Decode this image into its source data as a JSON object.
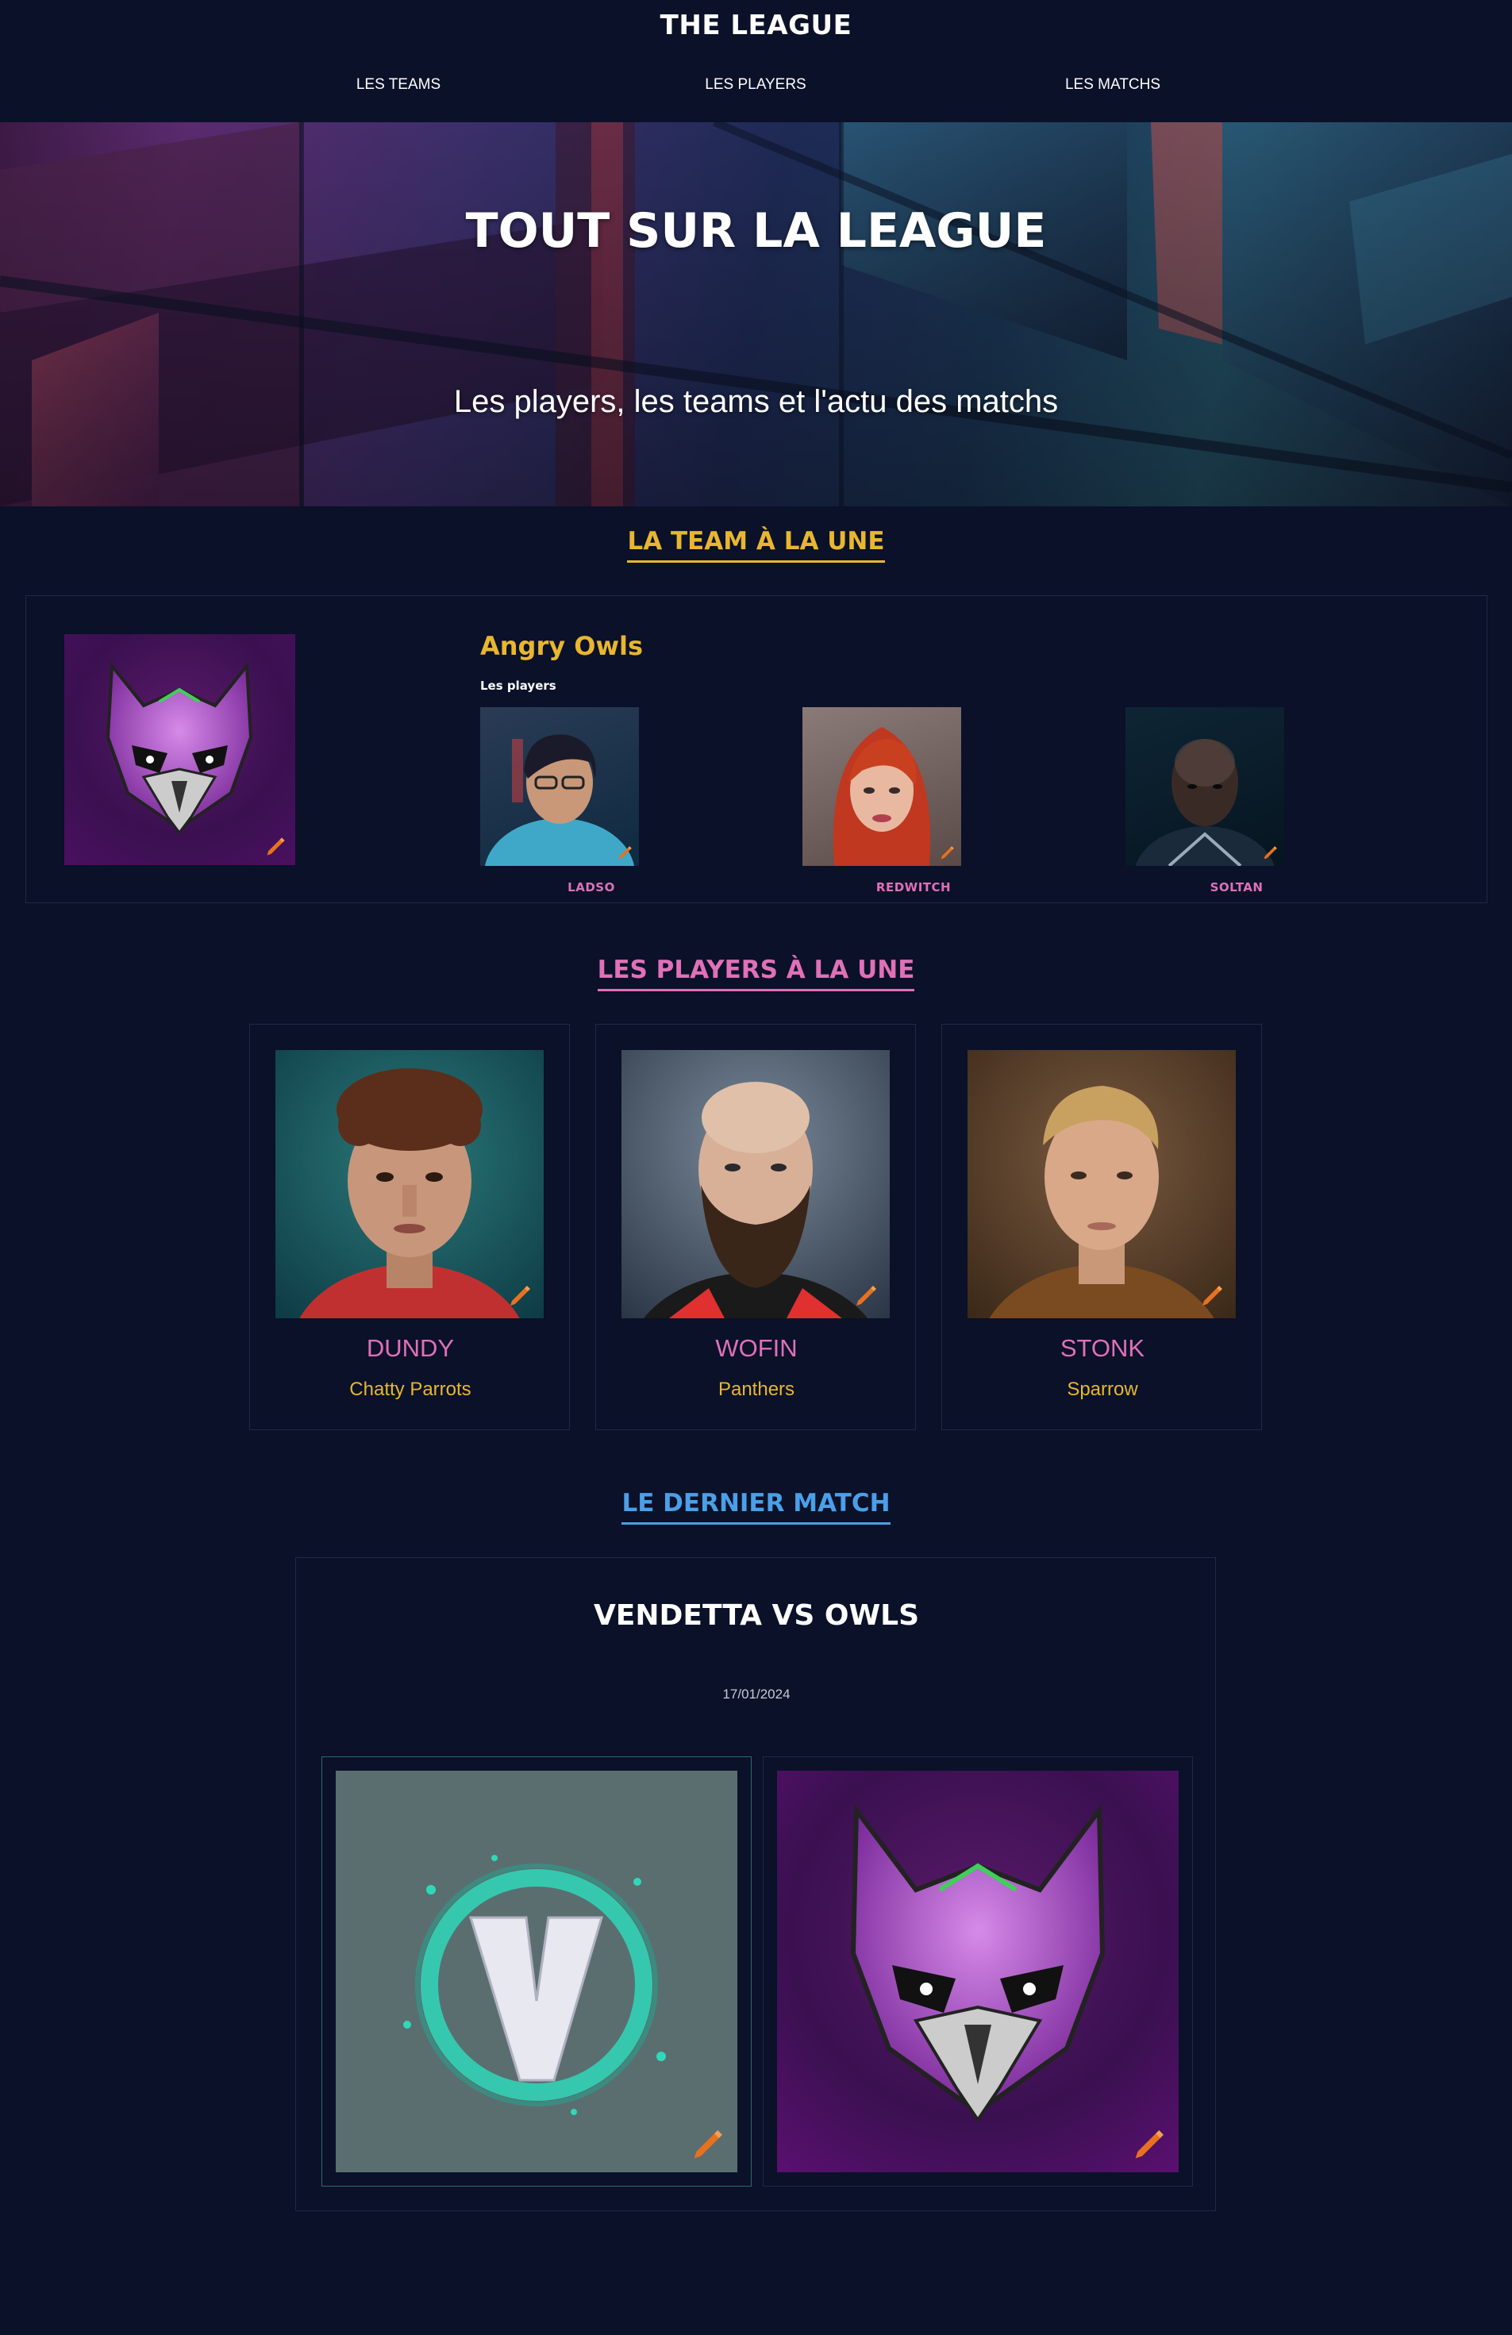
{
  "header": {
    "title": "THE LEAGUE",
    "nav": [
      "LES TEAMS",
      "LES PLAYERS",
      "LES MATCHS"
    ]
  },
  "hero": {
    "title": "TOUT SUR LA LEAGUE",
    "subtitle": "Les players, les teams et l'actu des matchs"
  },
  "featured_team": {
    "section_title": "LA TEAM À LA UNE",
    "team_name": "Angry Owls",
    "players_label": "Les players",
    "players": [
      "LADSO",
      "REDWITCH",
      "SOLTAN"
    ]
  },
  "featured_players": {
    "section_title": "LES PLAYERS À LA UNE",
    "cards": [
      {
        "name": "DUNDY",
        "team": "Chatty Parrots"
      },
      {
        "name": "WOFIN",
        "team": "Panthers"
      },
      {
        "name": "STONK",
        "team": "Sparrow"
      }
    ]
  },
  "last_match": {
    "section_title": "LE DERNIER MATCH",
    "title": "VENDETTA VS OWLS",
    "date": "17/01/2024"
  },
  "colors": {
    "background": "#0a1128",
    "gold": "#e8b630",
    "pink": "#e070b8",
    "blue": "#4a9fe8",
    "edit_orange": "#e8711f"
  },
  "icons": [
    "edit-pencil-icon",
    "owl-logo-icon",
    "vendetta-v-logo-icon"
  ]
}
